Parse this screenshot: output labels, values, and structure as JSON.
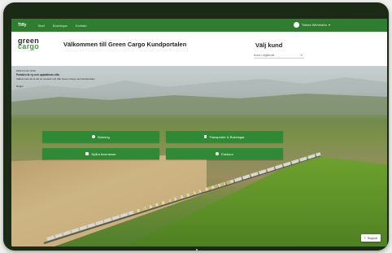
{
  "nav": {
    "brand": "Tiffy",
    "links": [
      "Start",
      "Bokningar",
      "Kontakt"
    ],
    "user": "Tobias Wehrhahn",
    "user_caret": "▾"
  },
  "header": {
    "logo_top": "green",
    "logo_bottom": "cargo",
    "welcome": "Välkommen till Green Cargo Kundportalen",
    "choose_customer": "Välj kund",
    "customer_select_value": "Kund i utgående",
    "select_chevron": "▾"
  },
  "info": {
    "date": "2021-01-01 12:00",
    "notice": "Portalen är ny och uppdateras ofta",
    "detail": "Välkommen att ta del av senaste nytt från Green Cargo via Kundportalen",
    "rules": "Regler"
  },
  "tiles": [
    {
      "label": "Bokning",
      "icon": "globe-icon"
    },
    {
      "label": "Transporter & Bokningar",
      "icon": "document-icon"
    },
    {
      "label": "Spåra leveranser",
      "icon": "truck-icon"
    },
    {
      "label": "Fakturor",
      "icon": "gear-icon"
    }
  ],
  "help": {
    "label": "Support",
    "icon": "question-icon",
    "glyph": "?"
  },
  "colors": {
    "brand_green": "#2f7d2f",
    "tile_green": "#2e8a35",
    "accent": "#3aa335"
  }
}
